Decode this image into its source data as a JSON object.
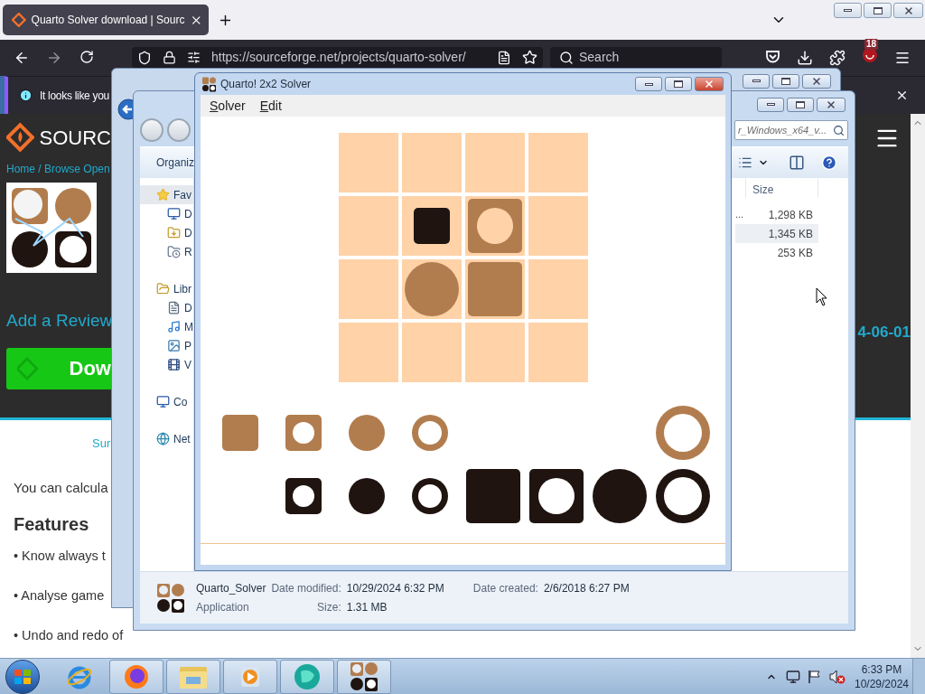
{
  "browser": {
    "tabs": [
      {
        "title": "Quarto Solver download | Sourc",
        "selected": true
      }
    ],
    "address": "https://sourceforge.net/projects/quarto-solver/",
    "search": {
      "placeholder": "Search"
    },
    "extension_badge": "18",
    "notification": "It looks like you",
    "page": {
      "brand": "SOURC",
      "breadcrumb": "Home / Browse Open",
      "add_review": "Add a Review",
      "download_button": "Dow",
      "date": "4-06-01",
      "tab_link": "Sur",
      "intro": "You can calcula",
      "features_heading": "Features",
      "features": [
        "• Know always t",
        "• Analyse game",
        "• Undo and redo of"
      ]
    }
  },
  "back_window": {
    "active": false
  },
  "explorer": {
    "active": false,
    "search": "r_Windows_x64_v...",
    "toolbar": "Organiz",
    "nav": [
      {
        "label": "Fav",
        "kind": "favorites",
        "selected": true,
        "children": [
          {
            "label": "D",
            "kind": "desktop",
            "selected": false
          },
          {
            "label": "D",
            "kind": "downloads",
            "selected": false
          },
          {
            "label": "R",
            "kind": "recent",
            "selected": false
          }
        ]
      },
      {
        "label": "Libr",
        "kind": "libraries",
        "selected": false,
        "children": [
          {
            "label": "D",
            "kind": "documents",
            "selected": false
          },
          {
            "label": "M",
            "kind": "music",
            "selected": false
          },
          {
            "label": "P",
            "kind": "pictures",
            "selected": false
          },
          {
            "label": "V",
            "kind": "videos",
            "selected": false
          }
        ]
      },
      {
        "label": "Co",
        "kind": "computer",
        "selected": false
      },
      {
        "label": "Net",
        "kind": "network",
        "selected": false
      }
    ],
    "column": "Size",
    "rows": [
      {
        "name": "...",
        "size": "1,298 KB",
        "selected": false
      },
      {
        "size": "1,345 KB",
        "selected": true
      },
      {
        "size": "253 KB",
        "selected": false
      }
    ],
    "details": {
      "name": "Quarto_Solver",
      "type": "Application",
      "modified_label": "Date modified:",
      "modified": "10/29/2024 6:32 PM",
      "created_label": "Date created:",
      "created": "2/6/2018 6:27 PM",
      "size_label": "Size:",
      "size": "1.31 MB"
    }
  },
  "quarto": {
    "active": true,
    "title": "Quarto! 2x2 Solver",
    "menu": [
      "Solver",
      "Edit"
    ],
    "board": [
      [
        {
          "kind": "empty"
        },
        {
          "kind": "empty"
        },
        {
          "kind": "empty"
        },
        {
          "kind": "empty"
        }
      ],
      [
        {
          "kind": "empty"
        },
        {
          "kind": "piece",
          "color": "#1f1410",
          "round": false,
          "hollow": false,
          "large": false
        },
        {
          "kind": "piece",
          "color": "#b27d4e",
          "round": false,
          "hollow": true,
          "large": true
        },
        {
          "kind": "empty"
        }
      ],
      [
        {
          "kind": "empty"
        },
        {
          "kind": "piece",
          "color": "#b27d4e",
          "round": true,
          "hollow": false,
          "large": true
        },
        {
          "kind": "piece",
          "color": "#b27d4e",
          "round": false,
          "hollow": false,
          "large": true
        },
        {
          "kind": "empty"
        }
      ],
      [
        {
          "kind": "empty"
        },
        {
          "kind": "empty"
        },
        {
          "kind": "empty"
        },
        {
          "kind": "empty"
        }
      ]
    ],
    "tray": [
      [
        {
          "kind": "piece",
          "color": "#b27d4e",
          "round": false,
          "hollow": false,
          "large": false
        },
        {
          "kind": "piece",
          "color": "#b27d4e",
          "round": false,
          "hollow": true,
          "large": false
        },
        {
          "kind": "piece",
          "color": "#b27d4e",
          "round": true,
          "hollow": false,
          "large": false
        },
        {
          "kind": "piece",
          "color": "#b27d4e",
          "round": true,
          "hollow": true,
          "large": false
        },
        {
          "kind": "empty"
        },
        {
          "kind": "empty"
        },
        {
          "kind": "empty"
        },
        {
          "kind": "piece",
          "color": "#b27d4e",
          "round": true,
          "hollow": true,
          "large": true
        }
      ],
      [
        {
          "kind": "empty"
        },
        {
          "kind": "piece",
          "color": "#1f1410",
          "round": false,
          "hollow": true,
          "large": false
        },
        {
          "kind": "piece",
          "color": "#1f1410",
          "round": true,
          "hollow": false,
          "large": false
        },
        {
          "kind": "piece",
          "color": "#1f1410",
          "round": true,
          "hollow": true,
          "large": false
        },
        {
          "kind": "piece",
          "color": "#1f1410",
          "round": false,
          "hollow": false,
          "large": true
        },
        {
          "kind": "piece",
          "color": "#1f1410",
          "round": false,
          "hollow": true,
          "large": true
        },
        {
          "kind": "piece",
          "color": "#1f1410",
          "round": true,
          "hollow": false,
          "large": true
        },
        {
          "kind": "piece",
          "color": "#1f1410",
          "round": true,
          "hollow": true,
          "large": true
        }
      ]
    ]
  },
  "taskbar": {
    "apps": [
      {
        "kind": "ie",
        "running": false
      },
      {
        "kind": "firefox",
        "running": true
      },
      {
        "kind": "explorer",
        "running": true
      },
      {
        "kind": "media",
        "running": true
      },
      {
        "kind": "globe",
        "running": true
      },
      {
        "kind": "quarto",
        "running": true
      }
    ],
    "clock": {
      "time": "6:33 PM",
      "date": "10/29/2024"
    }
  }
}
